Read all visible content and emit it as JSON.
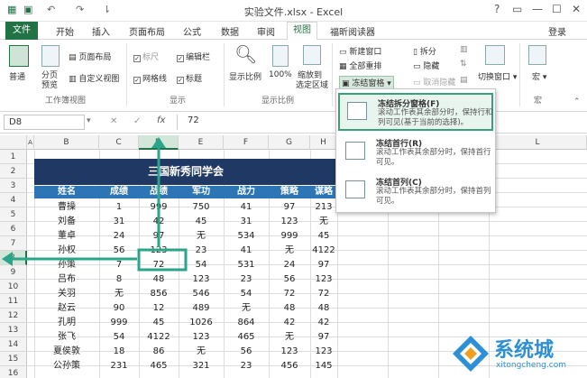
{
  "window": {
    "title": "实验文件.xlsx - Excel",
    "help": "?",
    "login": "登录"
  },
  "quick_access": {
    "undo": "↶",
    "redo": "↷"
  },
  "tabs": [
    "文件",
    "开始",
    "插入",
    "页面布局",
    "公式",
    "数据",
    "审阅",
    "视图",
    "福昕阅读器"
  ],
  "ribbon": {
    "workbook_views": {
      "normal": "普通",
      "page_break": [
        "分页",
        "预览"
      ],
      "page_layout": "页面布局",
      "custom_views": "自定义视图",
      "group": "工作簿视图"
    },
    "show": {
      "ruler": "标尺",
      "formula_bar": "编辑栏",
      "gridlines": "网格线",
      "headings": "标题",
      "group": "显示"
    },
    "zoom": {
      "zoom": "显示比例",
      "hundred": "100%",
      "zoom_selection": [
        "缩放到",
        "选定区域"
      ],
      "group": "显示比例"
    },
    "window": {
      "new_window": "新建窗口",
      "arrange_all": "全部重排",
      "freeze_panes": "冻结窗格",
      "split": "拆分",
      "hide": "隐藏",
      "unhide": "取消隐藏",
      "switch_windows": "切换窗口"
    },
    "macros": {
      "macros": "宏",
      "group": "宏"
    }
  },
  "formula_bar": {
    "name_box": "D8",
    "cancel": "✕",
    "enter": "✓",
    "fx": "fx",
    "value": "72"
  },
  "columns": [
    "A",
    "B",
    "C",
    "D",
    "E",
    "F",
    "G",
    "H",
    "I",
    "J",
    "K",
    "L"
  ],
  "rows": [
    "1",
    "2",
    "3",
    "4",
    "5",
    "6",
    "7",
    "8",
    "9",
    "10",
    "11",
    "12",
    "13",
    "14",
    "15",
    "16"
  ],
  "table": {
    "title": "三国新秀同学会",
    "headers": [
      "姓名",
      "成绩",
      "战绩",
      "军功",
      "战力",
      "策略",
      "谋略"
    ],
    "data": [
      [
        "曹操",
        "1",
        "999",
        "750",
        "41",
        "97",
        "213"
      ],
      [
        "刘备",
        "31",
        "42",
        "45",
        "31",
        "123",
        "无"
      ],
      [
        "董卓",
        "24",
        "97",
        "无",
        "534",
        "999",
        "45"
      ],
      [
        "孙权",
        "56",
        "123",
        "23",
        "41",
        "无",
        "4122"
      ],
      [
        "孙策",
        "7",
        "72",
        "54",
        "531",
        "24",
        "97"
      ],
      [
        "吕布",
        "8",
        "48",
        "123",
        "23",
        "56",
        "123"
      ],
      [
        "关羽",
        "无",
        "856",
        "546",
        "54",
        "72",
        "72"
      ],
      [
        "赵云",
        "90",
        "12",
        "489",
        "无",
        "48",
        "48"
      ],
      [
        "孔明",
        "999",
        "45",
        "1026",
        "864",
        "42",
        "42"
      ],
      [
        "张飞",
        "54",
        "4122",
        "123",
        "465",
        "无",
        "97"
      ],
      [
        "夏侯敦",
        "18",
        "86",
        "无",
        "56",
        "123",
        "123"
      ],
      [
        "公孙策",
        "231",
        "465",
        "321",
        "23",
        "456",
        "145"
      ],
      [
        "……",
        "……",
        "……",
        "……",
        "……",
        "……",
        "……"
      ]
    ]
  },
  "freeze_menu": [
    {
      "title": "冻结拆分窗格(F)",
      "desc": "滚动工作表其余部分时，保持行和列可见(基于当前的选择)。"
    },
    {
      "title": "冻结首行(R)",
      "desc": "滚动工作表其余部分时，保持首行可见。"
    },
    {
      "title": "冻结首列(C)",
      "desc": "滚动工作表其余部分时，保持首列可见。"
    }
  ],
  "watermark": {
    "brand": "系统城",
    "url": "xitongcheng.com"
  },
  "colors": {
    "excel_green": "#217346",
    "header_blue": "#2e75b6",
    "title_navy": "#1f3864",
    "highlight": "#3aa07a"
  }
}
